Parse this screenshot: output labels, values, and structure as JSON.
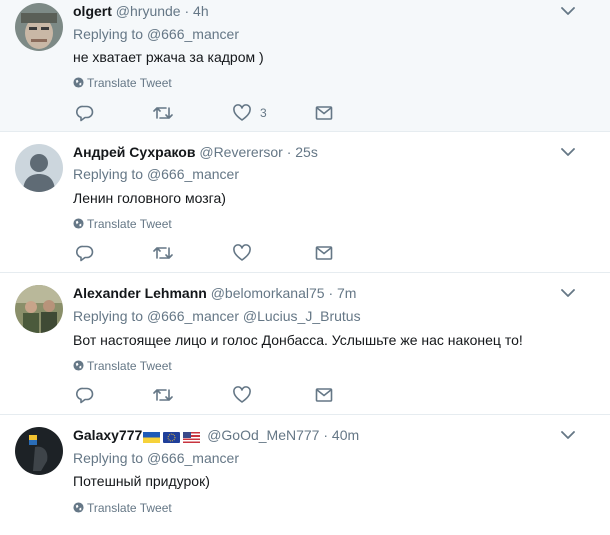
{
  "tweets": [
    {
      "name": "olgert",
      "handle": "@hryunde",
      "time": "4h",
      "replying_label": "Replying to",
      "replying_to": [
        "@666_mancer"
      ],
      "text": "не хватает ржача за кадром )",
      "translate": "Translate Tweet",
      "likes": "3",
      "highlighted": true
    },
    {
      "name": "Андрей Сухраков",
      "handle": "@Reverersor",
      "time": "25s",
      "replying_label": "Replying to",
      "replying_to": [
        "@666_mancer"
      ],
      "text": "Ленин головного мозга)",
      "translate": "Translate Tweet",
      "likes": "",
      "highlighted": false
    },
    {
      "name": "Alexander Lehmann",
      "handle": "@belomorkanal75",
      "time": "7m",
      "replying_label": "Replying to",
      "replying_to": [
        "@666_mancer",
        "@Lucius_J_Brutus"
      ],
      "text": "Вот настоящее лицо и голос Донбасса. Услышьте же нас наконец то!",
      "translate": "Translate Tweet",
      "likes": "",
      "highlighted": false
    },
    {
      "name": "Galaxy777",
      "handle": "@GoOd_MeN777",
      "time": "40m",
      "replying_label": "Replying to",
      "replying_to": [
        "@666_mancer"
      ],
      "text": "Потешный придурок)",
      "translate": "Translate Tweet",
      "likes": "",
      "highlighted": false,
      "flags": [
        "ukraine-flag",
        "eu-flag",
        "usa-flag"
      ]
    }
  ],
  "separator": "·",
  "colors": {
    "muted": "#657786",
    "text": "#14171a",
    "highlight_bg": "#f5f8fa",
    "border": "#e6ecf0"
  }
}
